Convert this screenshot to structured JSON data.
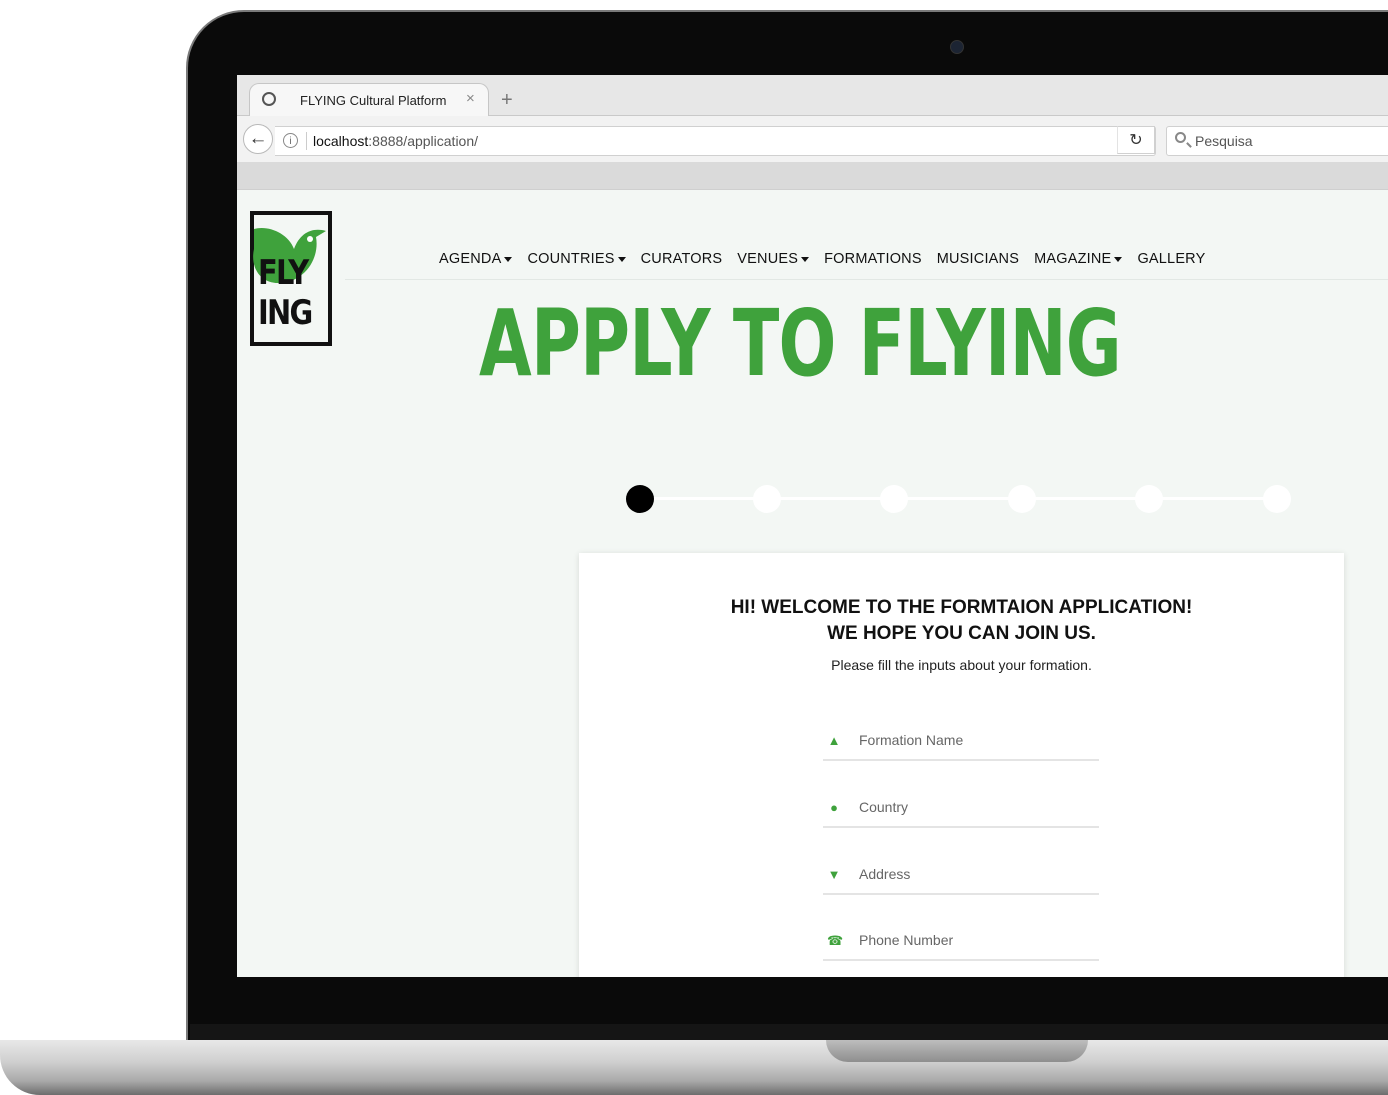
{
  "browser": {
    "tab_title": "FLYING Cultural Platform",
    "tab_close": "×",
    "new_tab": "+",
    "url_host": "localhost",
    "url_rest": ":8888/application/",
    "search_placeholder": "Pesquisa",
    "back_glyph": "←",
    "reload_glyph": "↻",
    "info_glyph": "i"
  },
  "logo": {
    "line1": "FLY",
    "line2": "ING"
  },
  "nav": {
    "items": [
      {
        "label": "AGENDA",
        "dropdown": true
      },
      {
        "label": "COUNTRIES",
        "dropdown": true
      },
      {
        "label": "CURATORS",
        "dropdown": false
      },
      {
        "label": "VENUES",
        "dropdown": true
      },
      {
        "label": "FORMATIONS",
        "dropdown": false
      },
      {
        "label": "MUSICIANS",
        "dropdown": false
      },
      {
        "label": "MAGAZINE",
        "dropdown": true
      },
      {
        "label": "GALLERY",
        "dropdown": false
      }
    ]
  },
  "hero": {
    "title": "APPLY TO FLYING"
  },
  "steps": {
    "total": 6,
    "current": 1
  },
  "form": {
    "heading_line1": "HI! WELCOME TO THE FORMTAION APPLICATION!",
    "heading_line2": "WE HOPE YOU CAN JOIN US.",
    "subtitle": "Please fill the inputs about your formation.",
    "fields": [
      {
        "placeholder": "Formation Name",
        "icon": "user-icon"
      },
      {
        "placeholder": "Country",
        "icon": "globe-icon"
      },
      {
        "placeholder": "Address",
        "icon": "map-pin-icon"
      },
      {
        "placeholder": "Phone Number",
        "icon": "phone-icon"
      }
    ]
  },
  "colors": {
    "brand_green": "#3fa23c",
    "page_bg": "#f3f7f4"
  }
}
